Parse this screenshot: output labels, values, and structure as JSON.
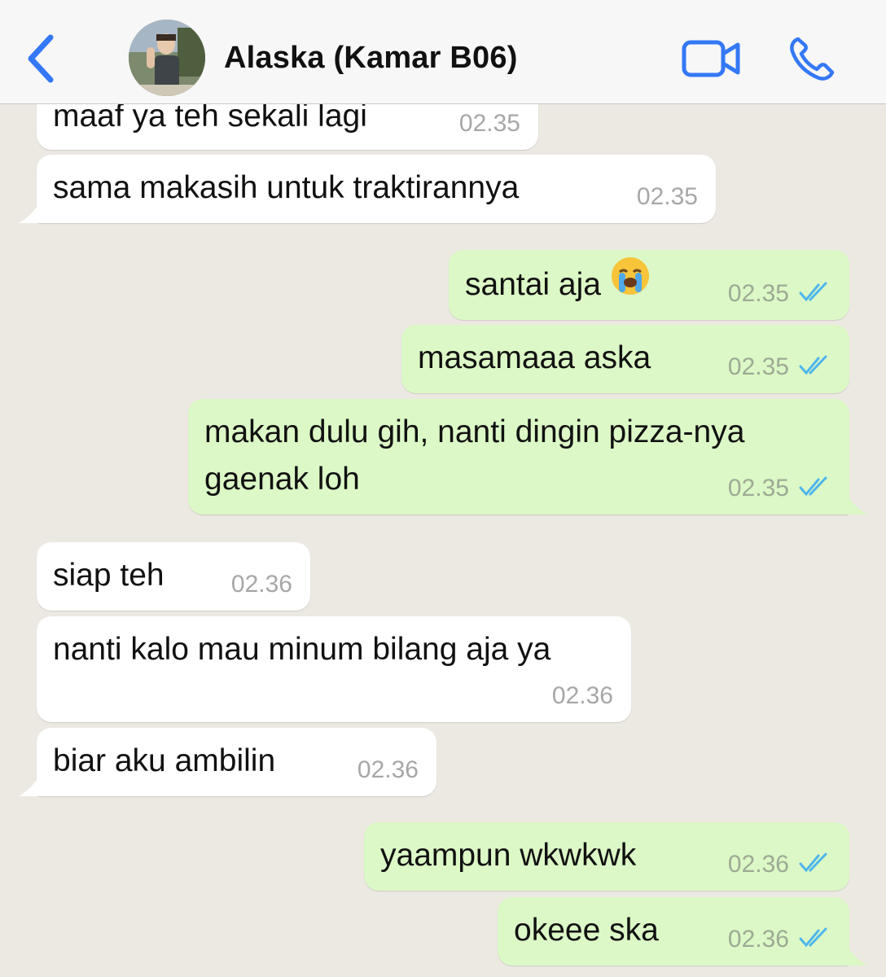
{
  "header": {
    "contact_name": "Alaska (Kamar B06)",
    "accent_color": "#3478F6",
    "icons": [
      "back-chevron-icon",
      "avatar",
      "video-camera-icon",
      "phone-icon"
    ]
  },
  "messages": [
    {
      "direction": "incoming",
      "text": "maaf ya teh sekali lagi",
      "time": "02.35"
    },
    {
      "direction": "incoming",
      "text": "sama makasih untuk traktirannya",
      "time": "02.35"
    },
    {
      "direction": "outgoing",
      "text": "santai aja",
      "emoji": "😭",
      "time": "02.35",
      "status": "read"
    },
    {
      "direction": "outgoing",
      "text": "masamaaa aska",
      "time": "02.35",
      "status": "read"
    },
    {
      "direction": "outgoing",
      "lines": [
        "makan dulu gih, nanti dingin pizza-nya",
        "gaenak loh"
      ],
      "time": "02.35",
      "status": "read"
    },
    {
      "direction": "incoming",
      "text": "siap teh",
      "time": "02.36"
    },
    {
      "direction": "incoming",
      "text": "nanti kalo mau minum bilang aja ya",
      "time": "02.36"
    },
    {
      "direction": "incoming",
      "text": "biar aku ambilin",
      "time": "02.36"
    },
    {
      "direction": "outgoing",
      "text": "yaampun wkwkwk",
      "time": "02.36",
      "status": "read"
    },
    {
      "direction": "outgoing",
      "text": "okeee ska",
      "time": "02.36",
      "status": "read"
    }
  ],
  "colors": {
    "incoming_bubble": "#FFFFFF",
    "outgoing_bubble": "#DCF8C6",
    "chat_background": "#ECE9E2",
    "read_ticks": "#4FB6EC"
  }
}
